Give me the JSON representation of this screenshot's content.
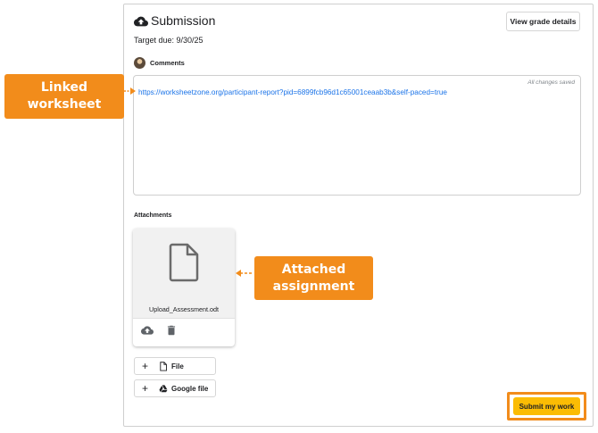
{
  "header": {
    "icon": "cloud-upload-icon",
    "title": "Submission",
    "grade_button": "View grade details",
    "due": "Target due: 9/30/25"
  },
  "comments": {
    "label": "Comments",
    "saved_status": "All changes saved",
    "link": "https://worksheetzone.org/participant-report?pid=6899fcb96d1c65001ceaab3b&self-paced=true"
  },
  "attachments": {
    "label": "Attachments",
    "file": {
      "name": "Upload_Assessment.odt",
      "icon": "document-icon",
      "actions": [
        "cloud-upload-icon",
        "trash-icon"
      ]
    },
    "add_buttons": [
      {
        "label": "File",
        "icon": "document-icon"
      },
      {
        "label": "Google file",
        "icon": "google-drive-icon"
      }
    ]
  },
  "submit_button": "Submit my work",
  "annotations": [
    {
      "line1": "Linked",
      "line2": "worksheet"
    },
    {
      "line1": "Attached",
      "line2": "assignment"
    }
  ],
  "colors": {
    "callout": "#f28c1b",
    "link": "#1a73e8",
    "submit": "#fbbc04"
  }
}
